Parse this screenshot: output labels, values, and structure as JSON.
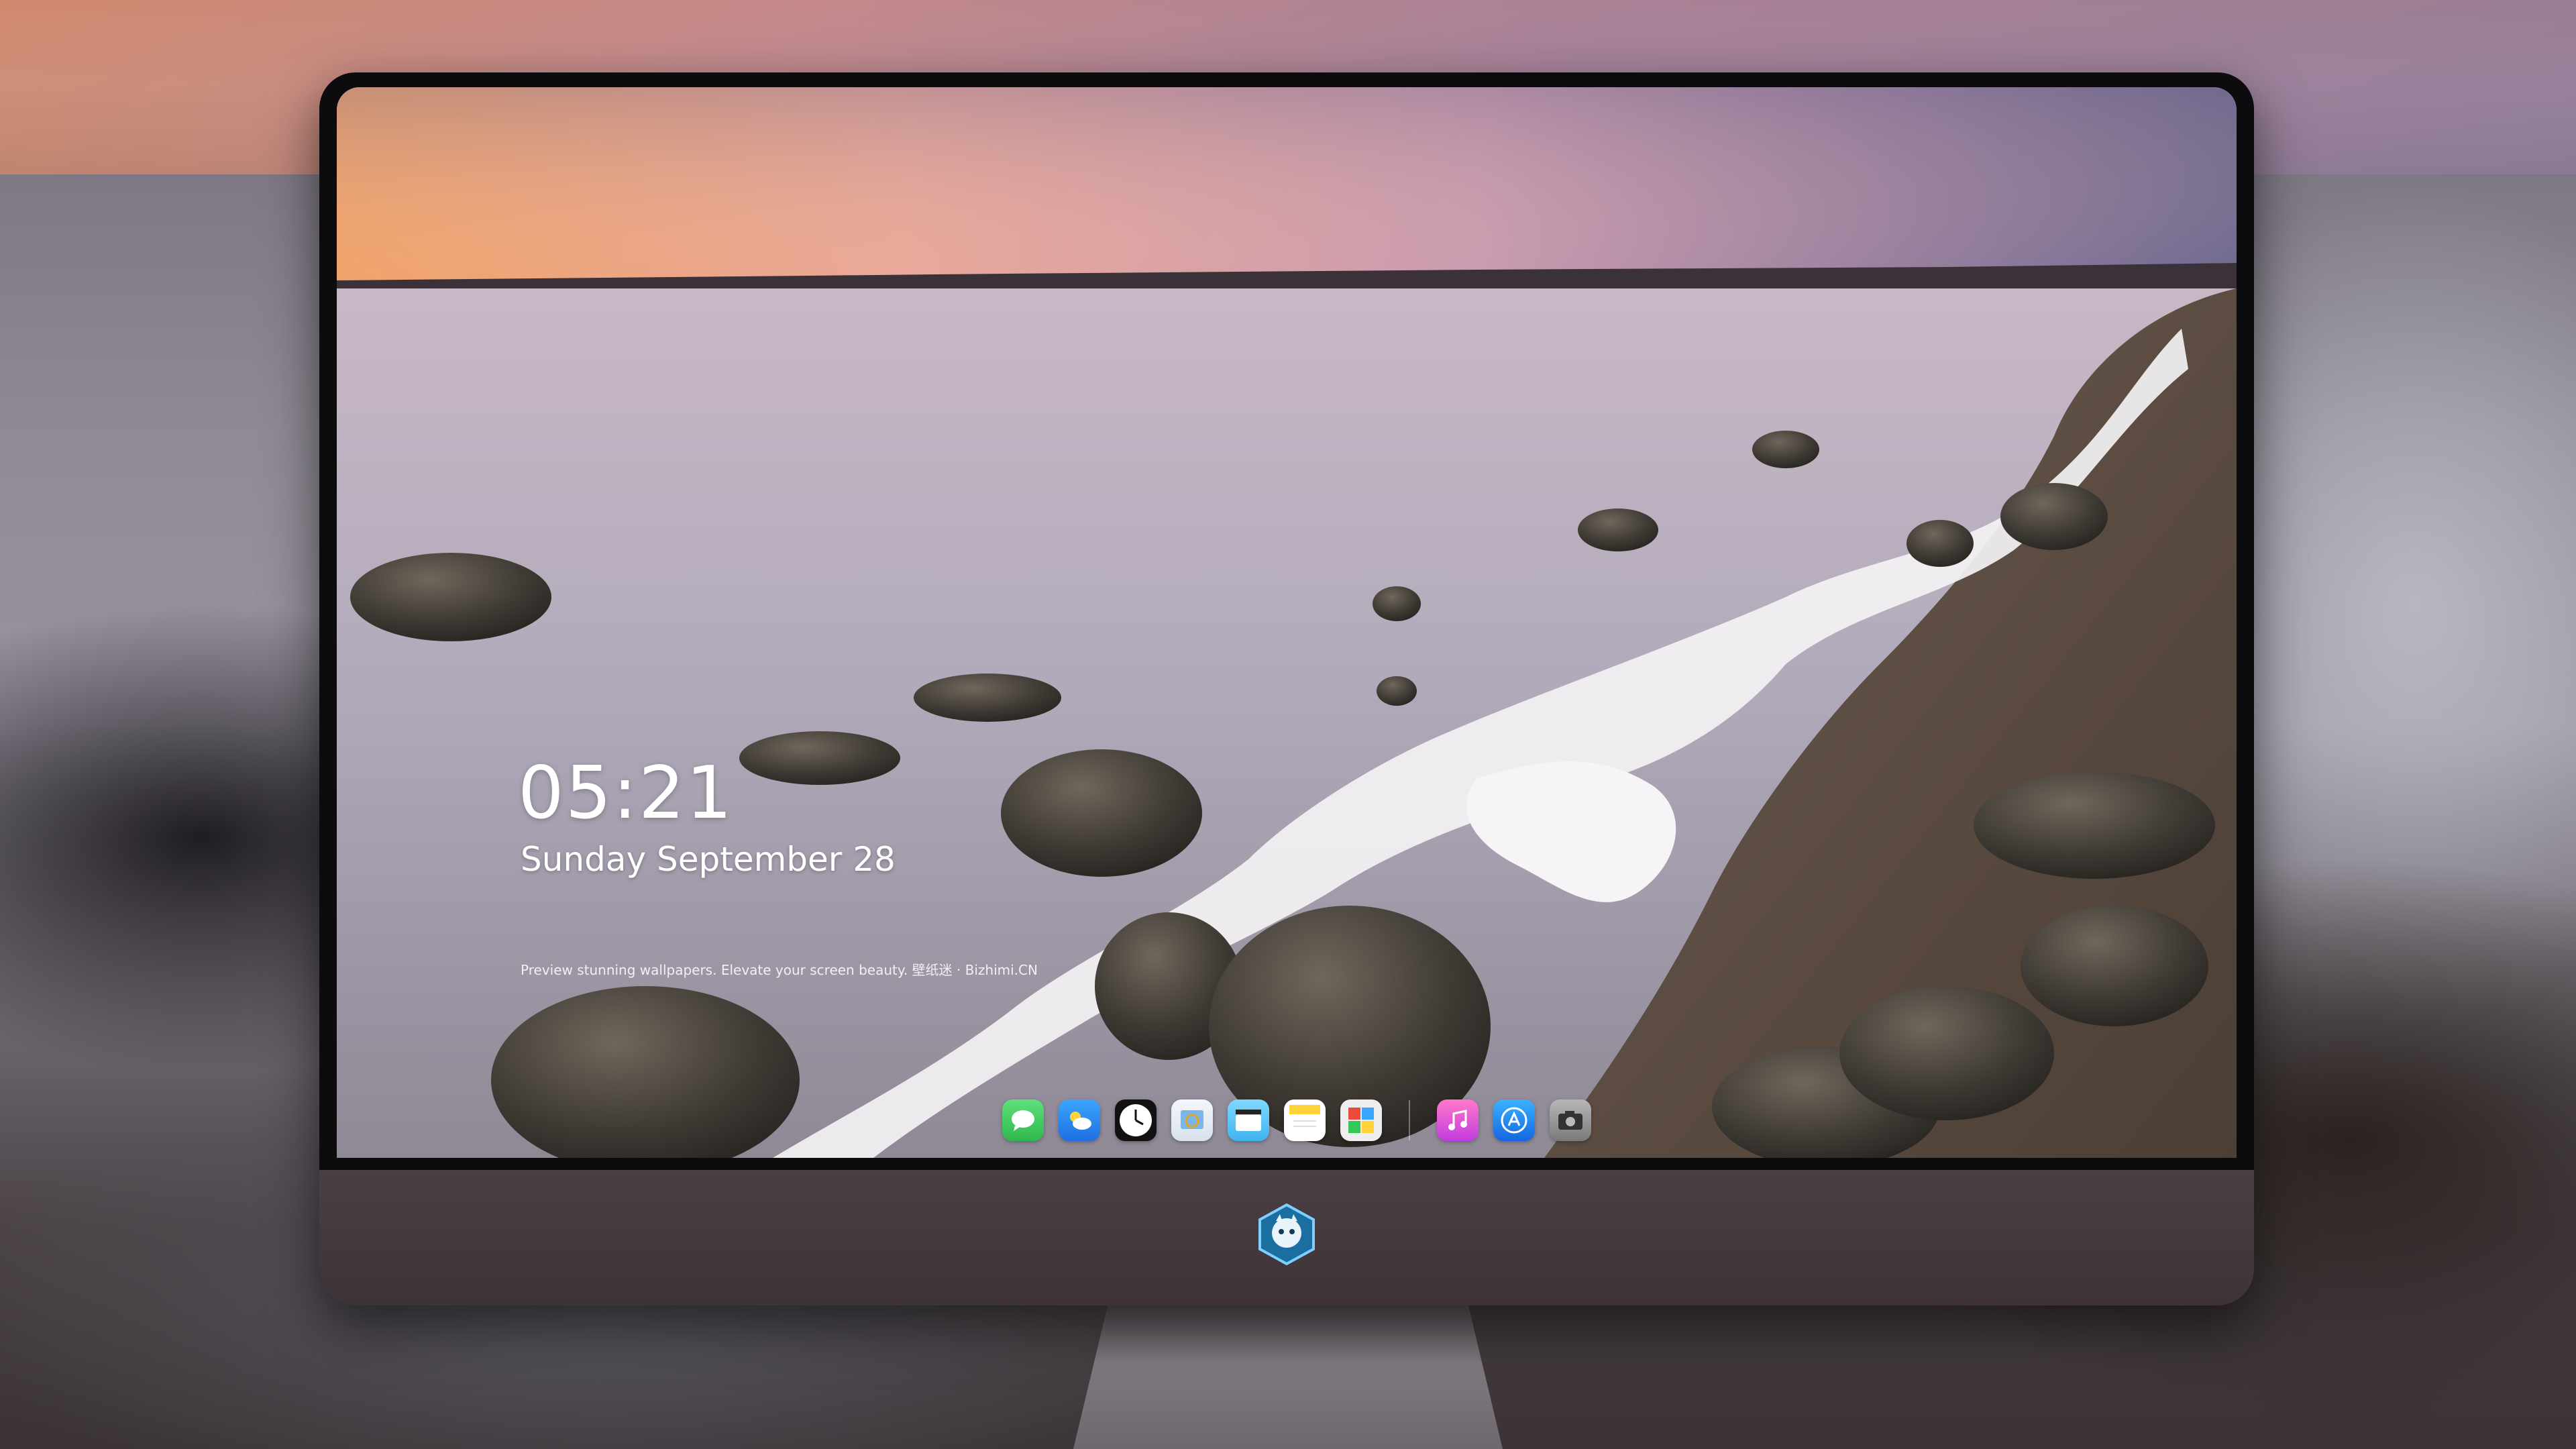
{
  "lockscreen": {
    "time": "05:21",
    "date": "Sunday September  28",
    "tagline": "Preview stunning wallpapers. Elevate your screen beauty. 壁纸迷 · Bizhimi.CN"
  },
  "dock": {
    "apps": [
      {
        "name": "messages-icon",
        "color": "#34c759"
      },
      {
        "name": "weather-icon",
        "color": "#2b8cf0"
      },
      {
        "name": "clock-icon",
        "color": "#ffffff"
      },
      {
        "name": "preview-icon",
        "color": "#e9eef4"
      },
      {
        "name": "clips-icon",
        "color": "#5ac8fa"
      },
      {
        "name": "notes-icon",
        "color": "#ffd54a"
      },
      {
        "name": "photo-booth-icon",
        "color": "#f2f2f2"
      },
      {
        "name": "music-icon",
        "color": "#f25ab5"
      },
      {
        "name": "app-store-icon",
        "color": "#1e90ff"
      },
      {
        "name": "camera-icon",
        "color": "#9a9a9a"
      }
    ]
  },
  "colors": {
    "sky_top": "#c88a7c",
    "sea": "#b6adbd",
    "foam": "#f4f2f4",
    "chin": "#463c40"
  }
}
